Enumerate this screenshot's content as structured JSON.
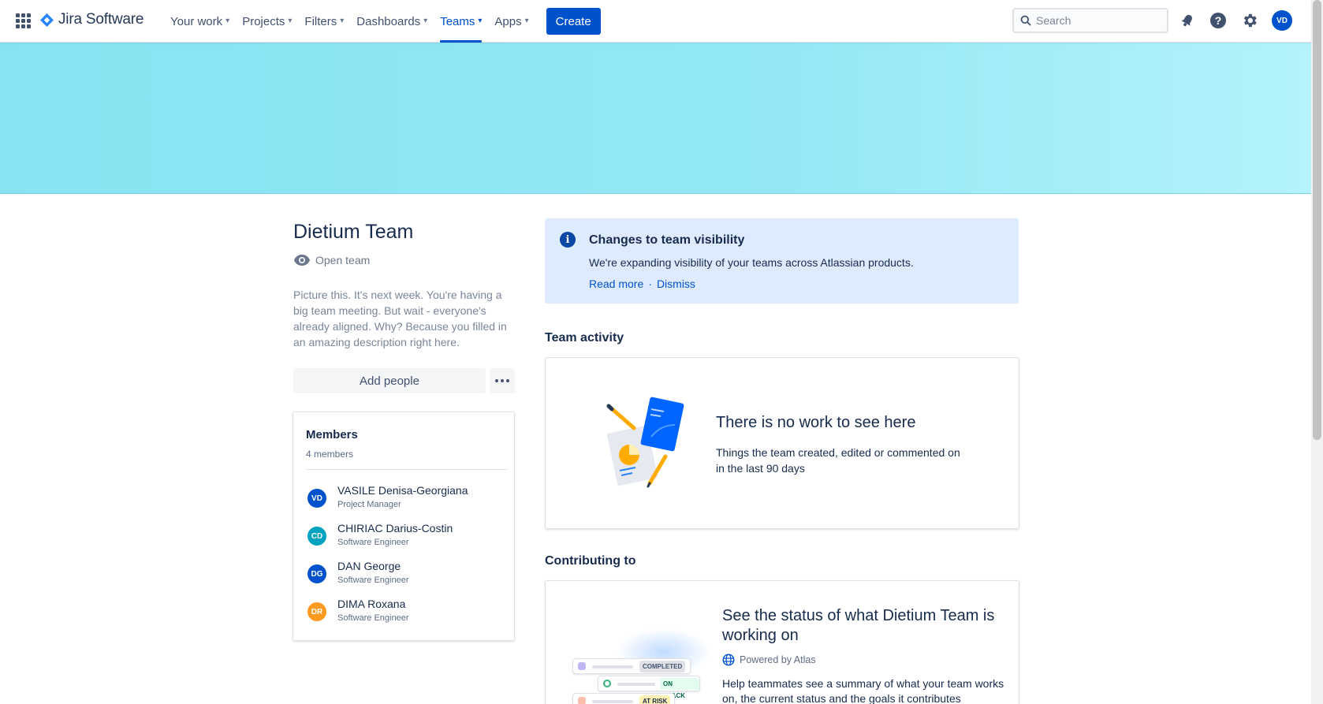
{
  "app": {
    "product_name": "Jira Software"
  },
  "nav": {
    "items": [
      {
        "label": "Your work"
      },
      {
        "label": "Projects"
      },
      {
        "label": "Filters"
      },
      {
        "label": "Dashboards"
      },
      {
        "label": "Teams",
        "active": true
      },
      {
        "label": "Apps"
      }
    ],
    "create_label": "Create",
    "search_placeholder": "Search",
    "user_initials": "VD"
  },
  "team": {
    "name": "Dietium Team",
    "visibility": "Open team",
    "description": "Picture this. It's next week. You're having a big team meeting. But wait - everyone's already aligned. Why? Because you filled in an amazing description right here.",
    "add_people_label": "Add people"
  },
  "members": {
    "title": "Members",
    "count_label": "4 members",
    "list": [
      {
        "initials": "VD",
        "name": "VASILE Denisa-Georgiana",
        "role": "Project Manager",
        "color": "#0052CC"
      },
      {
        "initials": "CD",
        "name": "CHIRIAC Darius-Costin",
        "role": "Software Engineer",
        "color": "#00A3BF"
      },
      {
        "initials": "DG",
        "name": "DAN George",
        "role": "Software Engineer",
        "color": "#0052CC"
      },
      {
        "initials": "DR",
        "name": "DIMA Roxana",
        "role": "Software Engineer",
        "color": "#FF991F"
      }
    ]
  },
  "info_panel": {
    "title": "Changes to team visibility",
    "text": "We're expanding visibility of your teams across Atlassian products.",
    "read_more": "Read more",
    "separator": "·",
    "dismiss": "Dismiss"
  },
  "activity": {
    "heading": "Team activity",
    "empty_title": "There is no work to see here",
    "empty_text": "Things the team created, edited or commented on in the last 90 days"
  },
  "contributing": {
    "heading": "Contributing to",
    "title": "See the status of what Dietium Team is working on",
    "powered_by": "Powered by Atlas",
    "text": "Help teammates see a summary of what your team works on, the current status and the goals it contributes",
    "status_labels": [
      "COMPLETED",
      "ON TRACK",
      "AT RISK"
    ]
  },
  "colors": {
    "brand": "#0052CC",
    "banner": "#8EE6F3",
    "info_bg": "#DEEBFF"
  }
}
